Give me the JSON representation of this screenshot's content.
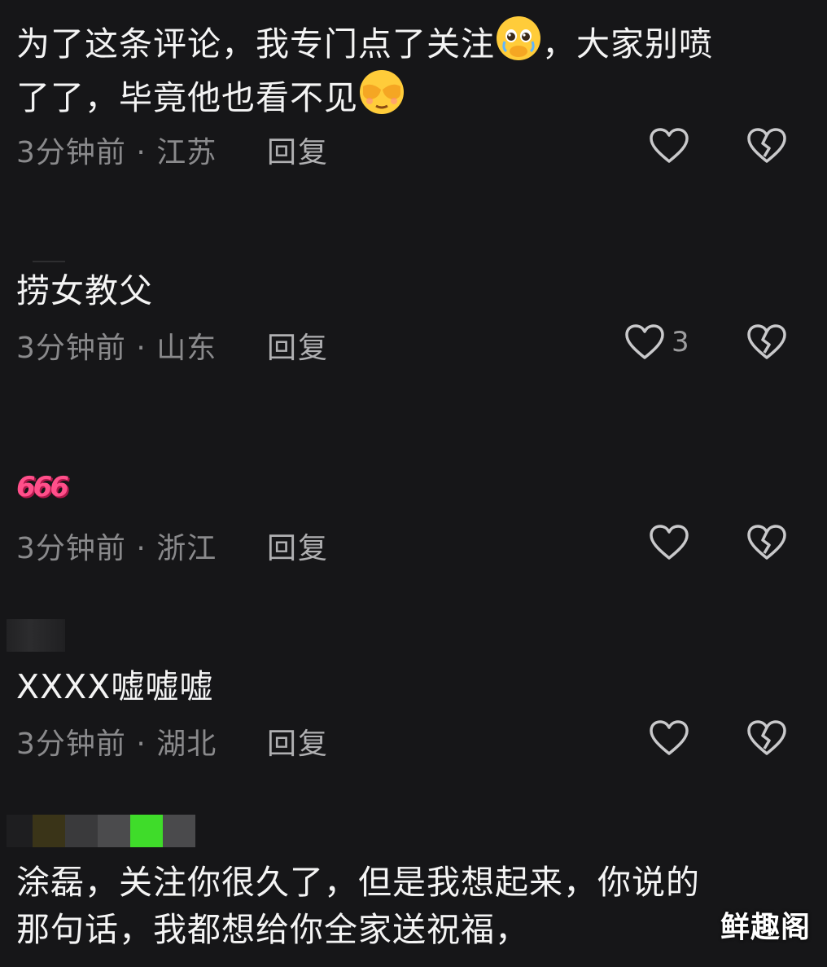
{
  "comments": [
    {
      "text_line1": "为了这条评论，我专门点了关注",
      "text_line1_end": "，大家别喷",
      "text_line2": "了了，毕竟他也看不见",
      "time": "3分钟前 · 江苏",
      "reply": "回复",
      "likes": ""
    },
    {
      "text": "捞女教父",
      "time": "3分钟前 · 山东",
      "reply": "回复",
      "likes": "3"
    },
    {
      "text": "666",
      "time": "3分钟前 · 浙江",
      "reply": "回复",
      "likes": ""
    },
    {
      "text": "XXXX嘘嘘嘘",
      "time": "3分钟前 · 湖北",
      "reply": "回复",
      "likes": ""
    },
    {
      "text_line1": "涂磊，关注你很久了，但是我想起来，你说的",
      "text_line2": "那句话，我都想给你全家送祝福，"
    }
  ],
  "watermark": "鲜趣阁",
  "icons": {
    "emoji1": "crying-face-hand-over-mouth-emoji",
    "emoji2": "face-covering-eyes-emoji",
    "like": "heart-outline-icon",
    "dislike": "broken-heart-icon"
  },
  "colors": {
    "background": "#161618",
    "text": "#f4f4f4",
    "meta": "#8a8a8c",
    "accent_666": "#ff4f8a"
  }
}
